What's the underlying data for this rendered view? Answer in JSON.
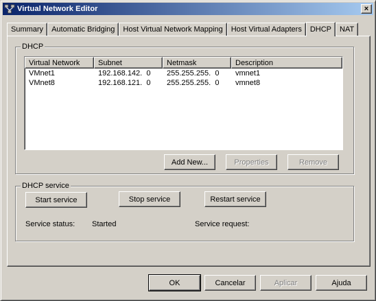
{
  "window": {
    "title": "Virtual Network Editor",
    "close_glyph": "×"
  },
  "tabs": [
    {
      "label": "Summary"
    },
    {
      "label": "Automatic Bridging"
    },
    {
      "label": "Host Virtual Network Mapping"
    },
    {
      "label": "Host Virtual Adapters"
    },
    {
      "label": "DHCP"
    },
    {
      "label": "NAT"
    }
  ],
  "dhcp_group": {
    "legend": "DHCP",
    "columns": [
      "Virtual Network",
      "Subnet",
      "Netmask",
      "Description"
    ],
    "rows": [
      [
        "VMnet1",
        "192.168.142.  0",
        "255.255.255.  0",
        "vmnet1"
      ],
      [
        "VMnet8",
        "192.168.121.  0",
        "255.255.255.  0",
        "vmnet8"
      ]
    ],
    "add_new_label": "Add New...",
    "properties_label": "Properties",
    "remove_label": "Remove"
  },
  "service_group": {
    "legend": "DHCP service",
    "start_label": "Start service",
    "stop_label": "Stop service",
    "restart_label": "Restart service",
    "status_label": "Service status:",
    "status_value": "Started",
    "request_label": "Service request:",
    "request_value": ""
  },
  "footer": {
    "ok_label": "OK",
    "cancel_label": "Cancelar",
    "apply_label": "Aplicar",
    "help_label": "Ajuda"
  },
  "colors": {
    "face": "#d4d0c8",
    "title_start": "#0a246a",
    "title_end": "#a6caf0",
    "disabled_text": "#808080"
  }
}
